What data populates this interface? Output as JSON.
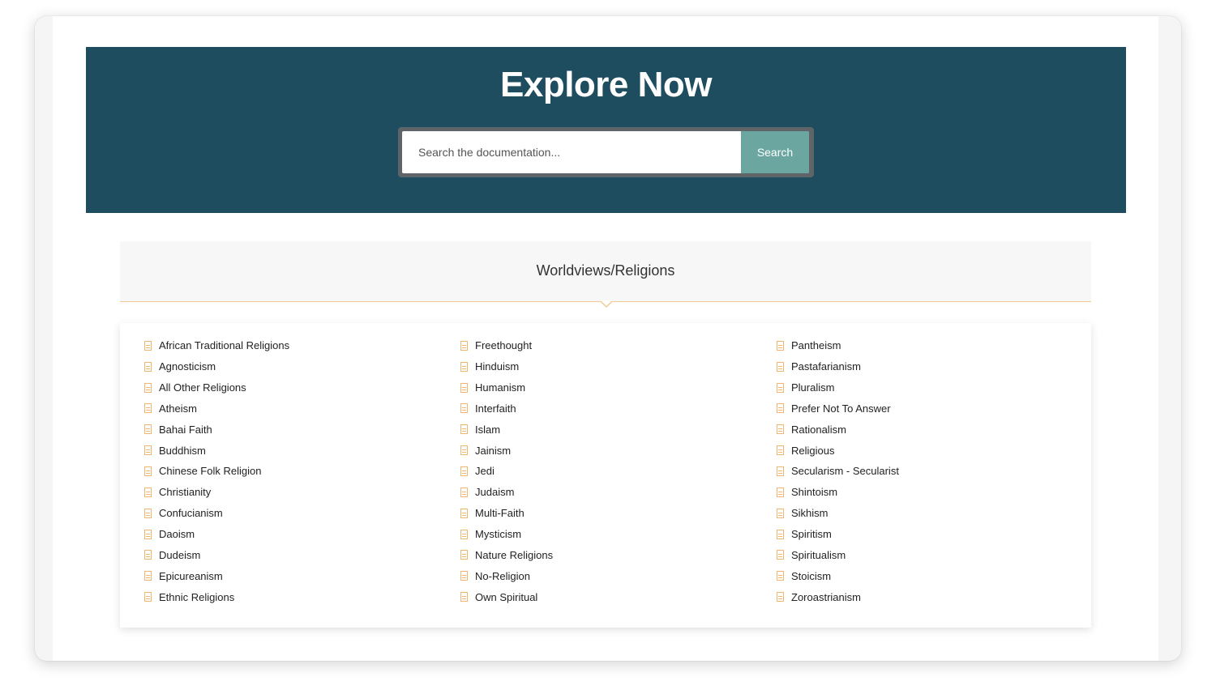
{
  "hero": {
    "title": "Explore Now",
    "search_placeholder": "Search the documentation...",
    "search_button": "Search"
  },
  "category": {
    "title": "Worldviews/Religions"
  },
  "columns": [
    [
      "African Traditional Religions",
      "Agnosticism",
      "All Other Religions",
      "Atheism",
      "Bahai Faith",
      "Buddhism",
      "Chinese Folk Religion",
      "Christianity",
      "Confucianism",
      "Daoism",
      "Dudeism",
      "Epicureanism",
      "Ethnic Religions"
    ],
    [
      "Freethought",
      "Hinduism",
      "Humanism",
      "Interfaith",
      "Islam",
      "Jainism",
      "Jedi",
      "Judaism",
      "Multi-Faith",
      "Mysticism",
      "Nature Religions",
      "No-Religion",
      "Own Spiritual"
    ],
    [
      "Pantheism",
      "Pastafarianism",
      "Pluralism",
      "Prefer Not To Answer",
      "Rationalism",
      "Religious",
      "Secularism - Secularist",
      "Shintoism",
      "Sikhism",
      "Spiritism",
      "Spiritualism",
      "Stoicism",
      "Zoroastrianism"
    ]
  ],
  "icons": {
    "list_item": "document-icon"
  },
  "colors": {
    "hero_bg": "#1f4d60",
    "search_button_bg": "#6ba7a0",
    "accent": "#f0c891"
  }
}
